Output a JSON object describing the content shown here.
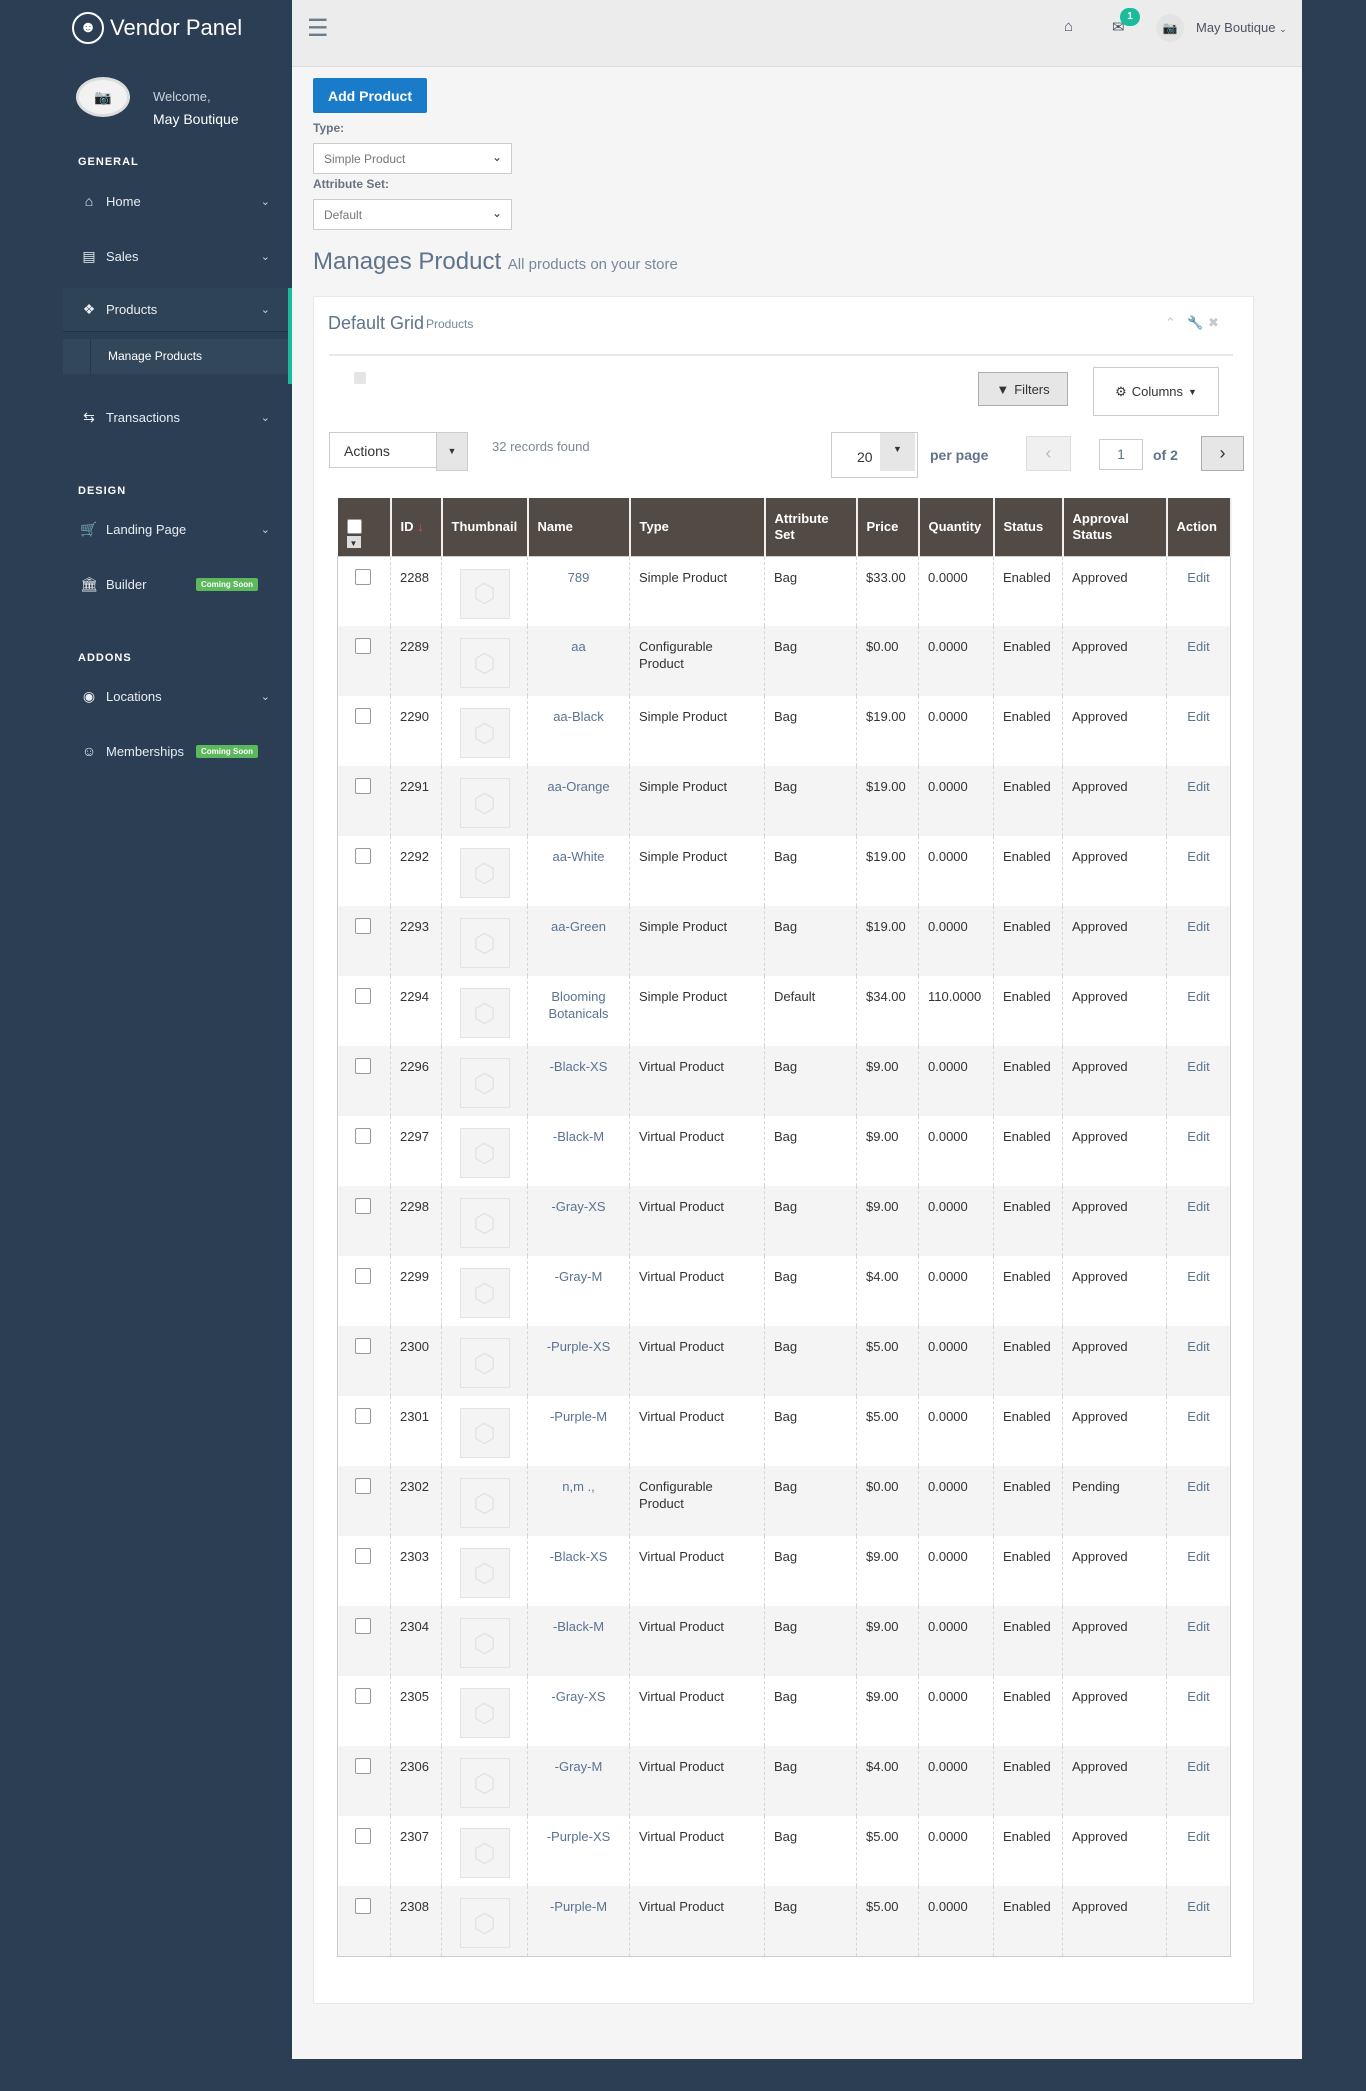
{
  "sidebar": {
    "brand": "Vendor Panel",
    "welcome": "Welcome,",
    "user": "May Boutique",
    "sections": {
      "general": "GENERAL",
      "design": "DESIGN",
      "addons": "ADDONS"
    },
    "items": {
      "home": "Home",
      "sales": "Sales",
      "products": "Products",
      "manage_products": "Manage Products",
      "transactions": "Transactions",
      "landing": "Landing Page",
      "builder": "Builder",
      "locations": "Locations",
      "memberships": "Memberships"
    },
    "badge": "Coming Soon"
  },
  "topbar": {
    "mail_count": "1",
    "user": "May Boutique"
  },
  "form": {
    "add_button": "Add Product",
    "type_label": "Type:",
    "type_value": "Simple Product",
    "attr_label": "Attribute Set:",
    "attr_value": "Default"
  },
  "page": {
    "title": "Manages Product",
    "subtitle": "All products on your store"
  },
  "grid": {
    "title": "Default Grid",
    "subtitle": "Products",
    "filters": "Filters",
    "columns": "Columns",
    "actions": "Actions",
    "records": "32 records found",
    "per_page_value": "20",
    "per_page": "per page",
    "page": "1",
    "of": "of 2"
  },
  "headers": [
    "ID",
    "Thumbnail",
    "Name",
    "Type",
    "Attribute Set",
    "Price",
    "Quantity",
    "Status",
    "Approval Status",
    "Action"
  ],
  "rows": [
    [
      "2288",
      "789",
      "Simple Product",
      "Bag",
      "$33.00",
      "0.0000",
      "Enabled",
      "Approved",
      "Edit"
    ],
    [
      "2289",
      "aa",
      "Configurable Product",
      "Bag",
      "$0.00",
      "0.0000",
      "Enabled",
      "Approved",
      "Edit"
    ],
    [
      "2290",
      "aa-Black",
      "Simple Product",
      "Bag",
      "$19.00",
      "0.0000",
      "Enabled",
      "Approved",
      "Edit"
    ],
    [
      "2291",
      "aa-Orange",
      "Simple Product",
      "Bag",
      "$19.00",
      "0.0000",
      "Enabled",
      "Approved",
      "Edit"
    ],
    [
      "2292",
      "aa-White",
      "Simple Product",
      "Bag",
      "$19.00",
      "0.0000",
      "Enabled",
      "Approved",
      "Edit"
    ],
    [
      "2293",
      "aa-Green",
      "Simple Product",
      "Bag",
      "$19.00",
      "0.0000",
      "Enabled",
      "Approved",
      "Edit"
    ],
    [
      "2294",
      "Blooming Botanicals",
      "Simple Product",
      "Default",
      "$34.00",
      "110.0000",
      "Enabled",
      "Approved",
      "Edit"
    ],
    [
      "2296",
      "-Black-XS",
      "Virtual Product",
      "Bag",
      "$9.00",
      "0.0000",
      "Enabled",
      "Approved",
      "Edit"
    ],
    [
      "2297",
      "-Black-M",
      "Virtual Product",
      "Bag",
      "$9.00",
      "0.0000",
      "Enabled",
      "Approved",
      "Edit"
    ],
    [
      "2298",
      "-Gray-XS",
      "Virtual Product",
      "Bag",
      "$9.00",
      "0.0000",
      "Enabled",
      "Approved",
      "Edit"
    ],
    [
      "2299",
      "-Gray-M",
      "Virtual Product",
      "Bag",
      "$4.00",
      "0.0000",
      "Enabled",
      "Approved",
      "Edit"
    ],
    [
      "2300",
      "-Purple-XS",
      "Virtual Product",
      "Bag",
      "$5.00",
      "0.0000",
      "Enabled",
      "Approved",
      "Edit"
    ],
    [
      "2301",
      "-Purple-M",
      "Virtual Product",
      "Bag",
      "$5.00",
      "0.0000",
      "Enabled",
      "Approved",
      "Edit"
    ],
    [
      "2302",
      "n,m .,",
      "Configurable Product",
      "Bag",
      "$0.00",
      "0.0000",
      "Enabled",
      "Pending",
      "Edit"
    ],
    [
      "2303",
      "-Black-XS",
      "Virtual Product",
      "Bag",
      "$9.00",
      "0.0000",
      "Enabled",
      "Approved",
      "Edit"
    ],
    [
      "2304",
      "-Black-M",
      "Virtual Product",
      "Bag",
      "$9.00",
      "0.0000",
      "Enabled",
      "Approved",
      "Edit"
    ],
    [
      "2305",
      "-Gray-XS",
      "Virtual Product",
      "Bag",
      "$9.00",
      "0.0000",
      "Enabled",
      "Approved",
      "Edit"
    ],
    [
      "2306",
      "-Gray-M",
      "Virtual Product",
      "Bag",
      "$4.00",
      "0.0000",
      "Enabled",
      "Approved",
      "Edit"
    ],
    [
      "2307",
      "-Purple-XS",
      "Virtual Product",
      "Bag",
      "$5.00",
      "0.0000",
      "Enabled",
      "Approved",
      "Edit"
    ],
    [
      "2308",
      "-Purple-M",
      "Virtual Product",
      "Bag",
      "$5.00",
      "0.0000",
      "Enabled",
      "Approved",
      "Edit"
    ]
  ],
  "colors": {
    "sidebar": "#2b3e53",
    "accent": "#1abc9c",
    "primary": "#1a7bc9",
    "table_header": "#524a45",
    "link": "#5a7391",
    "badge": "#5cb85c"
  }
}
